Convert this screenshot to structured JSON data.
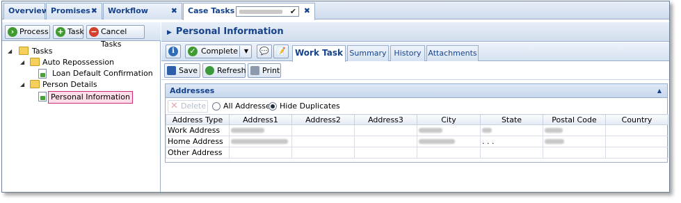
{
  "top_tabs": [
    {
      "label": "Overview"
    },
    {
      "label": "Promises",
      "close": "✖"
    },
    {
      "label": "Workflow History",
      "close": "✖"
    },
    {
      "label": "Case Tasks",
      "close": "✖",
      "checkmark": "✔"
    }
  ],
  "left_toolbar": {
    "process": "Process",
    "task": "Task",
    "cancel_tasks": "Cancel Tasks"
  },
  "tree": {
    "root": "Tasks",
    "group1": "Auto Repossession",
    "group1_item": "Loan Default Confirmation",
    "group2": "Person Details",
    "group2_item": "Personal Information"
  },
  "right_header": {
    "title": "Personal Information"
  },
  "right_toolbar": {
    "info_icon": "i",
    "complete": "Complete",
    "tabs": [
      "Work Task",
      "Summary",
      "History",
      "Attachments"
    ]
  },
  "actions": {
    "save": "Save",
    "refresh": "Refresh",
    "print": "Print"
  },
  "addresses": {
    "title": "Addresses",
    "delete": "Delete",
    "all_addresses": "All Addresses",
    "hide_duplicates": "Hide Duplicates",
    "hide_duplicates_selected": true,
    "columns": [
      "Address Type",
      "Address1",
      "Address2",
      "Address3",
      "City",
      "State",
      "Postal Code",
      "Country"
    ],
    "rows": [
      {
        "type": "Work Address",
        "state_text": ""
      },
      {
        "type": "Home Address",
        "state_text": ". . ."
      },
      {
        "type": "Other Address",
        "state_text": ""
      }
    ]
  },
  "colors": {
    "accent_text": "#15428b",
    "selected_border": "#cf2c70",
    "selected_fill": "#fcdde8"
  }
}
